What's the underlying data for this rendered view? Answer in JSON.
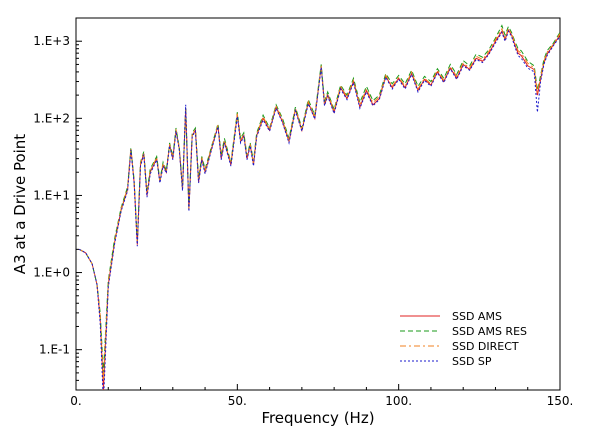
{
  "chart_data": {
    "type": "line",
    "title": "",
    "xlabel": "Frequency (Hz)",
    "ylabel": "A3 at a Drive Point",
    "xlim": [
      0,
      150
    ],
    "ylim": [
      0.03,
      2000
    ],
    "yscale": "log",
    "x_ticks": [
      {
        "value": 0,
        "label": "0."
      },
      {
        "value": 50,
        "label": "50."
      },
      {
        "value": 100,
        "label": "100."
      },
      {
        "value": 150,
        "label": "150."
      }
    ],
    "y_ticks": [
      {
        "value": 0.1,
        "label": "1.E-1"
      },
      {
        "value": 1,
        "label": "1.E+0"
      },
      {
        "value": 10,
        "label": "1.E+1"
      },
      {
        "value": 100,
        "label": "1.E+2"
      },
      {
        "value": 1000,
        "label": "1.E+3"
      }
    ],
    "grid": false,
    "legend_position": "bottom-right",
    "x": [
      1,
      3,
      5,
      6.5,
      7.5,
      8.5,
      10,
      12,
      14,
      16,
      17,
      18,
      19,
      20,
      21,
      22,
      23,
      25,
      26,
      27,
      28,
      29,
      30,
      31,
      32,
      33,
      34,
      35,
      36,
      37,
      38,
      39,
      40,
      42,
      44,
      45,
      46,
      47,
      48,
      50,
      51,
      52,
      53,
      54,
      55,
      56,
      58,
      60,
      62,
      64,
      66,
      68,
      70,
      72,
      74,
      76,
      77,
      78,
      80,
      82,
      84,
      86,
      88,
      90,
      92,
      94,
      96,
      98,
      100,
      102,
      104,
      106,
      108,
      110,
      112,
      114,
      116,
      118,
      120,
      122,
      124,
      126,
      128,
      130,
      132,
      133,
      134,
      135,
      136,
      137,
      138,
      140,
      142,
      143,
      144,
      145,
      146,
      148,
      150
    ],
    "series": [
      {
        "name": "SSD AMS",
        "values": [
          2.0,
          1.8,
          1.3,
          0.7,
          0.25,
          0.03,
          0.7,
          2.5,
          6.5,
          12,
          40,
          15,
          2.3,
          25,
          35,
          10,
          20,
          30,
          15,
          25,
          20,
          45,
          30,
          70,
          40,
          12,
          130,
          6.5,
          60,
          70,
          15,
          30,
          20,
          40,
          80,
          30,
          50,
          35,
          25,
          110,
          50,
          60,
          30,
          45,
          25,
          60,
          100,
          70,
          140,
          90,
          50,
          130,
          70,
          160,
          100,
          470,
          150,
          200,
          120,
          250,
          180,
          300,
          140,
          230,
          150,
          180,
          350,
          250,
          330,
          250,
          380,
          230,
          320,
          270,
          400,
          300,
          450,
          330,
          500,
          430,
          600,
          550,
          700,
          1000,
          1350,
          1050,
          1400,
          1200,
          900,
          700,
          650,
          480,
          430,
          200,
          320,
          520,
          680,
          900,
          1200
        ]
      },
      {
        "name": "SSD AMS RES",
        "values": [
          2.0,
          1.8,
          1.3,
          0.7,
          0.3,
          0.05,
          0.8,
          2.8,
          7,
          13,
          42,
          16,
          2.6,
          27,
          37,
          11,
          22,
          32,
          16,
          27,
          21,
          48,
          32,
          75,
          42,
          13,
          140,
          7,
          65,
          75,
          17,
          32,
          22,
          43,
          85,
          33,
          55,
          38,
          27,
          120,
          55,
          65,
          33,
          48,
          28,
          65,
          110,
          75,
          150,
          100,
          55,
          140,
          75,
          175,
          110,
          500,
          165,
          220,
          130,
          270,
          200,
          330,
          160,
          260,
          170,
          200,
          380,
          280,
          360,
          280,
          420,
          260,
          350,
          300,
          440,
          330,
          500,
          370,
          560,
          480,
          680,
          620,
          780,
          1100,
          1600,
          1200,
          1550,
          1300,
          1000,
          800,
          750,
          550,
          480,
          230,
          360,
          580,
          750,
          950,
          1300
        ]
      },
      {
        "name": "SSD DIRECT",
        "values": [
          2.0,
          1.8,
          1.3,
          0.7,
          0.28,
          0.04,
          0.75,
          2.6,
          6.8,
          12.5,
          41,
          15.5,
          2.4,
          26,
          36,
          10.5,
          21,
          31,
          15.5,
          26,
          20.5,
          46,
          31,
          72,
          41,
          12.5,
          135,
          6.8,
          62,
          72,
          16,
          31,
          21,
          42,
          82,
          32,
          52,
          36,
          26,
          115,
          52,
          62,
          32,
          46,
          26,
          62,
          105,
          72,
          145,
          95,
          52,
          135,
          72,
          165,
          105,
          480,
          155,
          210,
          125,
          260,
          190,
          310,
          150,
          240,
          160,
          190,
          360,
          260,
          340,
          260,
          400,
          240,
          330,
          280,
          420,
          310,
          470,
          350,
          520,
          450,
          640,
          580,
          740,
          1050,
          1450,
          1100,
          1450,
          1250,
          950,
          750,
          700,
          520,
          450,
          215,
          340,
          550,
          720,
          920,
          1250
        ]
      },
      {
        "name": "SSD SP",
        "values": [
          2.0,
          1.8,
          1.3,
          0.7,
          0.22,
          0.02,
          0.65,
          2.4,
          6.3,
          11.5,
          39,
          14.5,
          2.2,
          24,
          34,
          9.5,
          19,
          29,
          14.5,
          24,
          19.5,
          44,
          29,
          68,
          39,
          11.5,
          150,
          6.2,
          58,
          68,
          14.5,
          29,
          19,
          39,
          78,
          29,
          48,
          34,
          24,
          105,
          48,
          58,
          29,
          44,
          24,
          58,
          95,
          68,
          135,
          88,
          48,
          125,
          68,
          155,
          98,
          460,
          145,
          195,
          115,
          240,
          175,
          290,
          135,
          220,
          145,
          175,
          340,
          240,
          320,
          240,
          370,
          220,
          310,
          260,
          390,
          290,
          440,
          320,
          480,
          420,
          580,
          530,
          680,
          950,
          1300,
          1000,
          1350,
          1150,
          850,
          650,
          600,
          450,
          400,
          120,
          300,
          500,
          650,
          880,
          1150
        ]
      }
    ],
    "series_colors": [
      "#e02020",
      "#1a9a1a",
      "#f08020",
      "#1a1acc"
    ],
    "series_dash": [
      "none",
      "5,3",
      "6,3,2,3",
      "2,2"
    ]
  }
}
